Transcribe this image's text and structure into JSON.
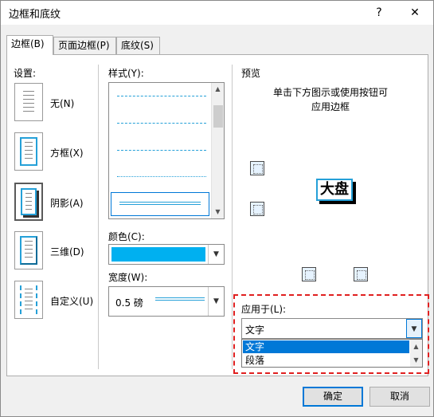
{
  "window": {
    "title": "边框和底纹",
    "help": "?",
    "close": "✕"
  },
  "tabs": [
    {
      "label": "边框(B)"
    },
    {
      "label": "页面边框(P)"
    },
    {
      "label": "底纹(S)"
    }
  ],
  "settings": {
    "heading": "设置:",
    "items": [
      {
        "label": "无(N)"
      },
      {
        "label": "方框(X)"
      },
      {
        "label": "阴影(A)"
      },
      {
        "label": "三维(D)"
      },
      {
        "label": "自定义(U)"
      }
    ]
  },
  "style": {
    "label": "样式(Y):"
  },
  "color": {
    "label": "颜色(C):",
    "value_color": "#00b0f0"
  },
  "width": {
    "label": "宽度(W):",
    "value": "0.5 磅"
  },
  "preview": {
    "heading": "预览",
    "hint_line1": "单击下方图示或使用按钮可",
    "hint_line2": "应用边框",
    "sample": "大盘"
  },
  "apply_to": {
    "label": "应用于(L):",
    "value": "文字",
    "options": [
      "文字",
      "段落"
    ]
  },
  "buttons": {
    "ok": "确定",
    "cancel": "取消"
  },
  "colors": {
    "accent": "#0078d7",
    "highlight": "#e02020"
  }
}
